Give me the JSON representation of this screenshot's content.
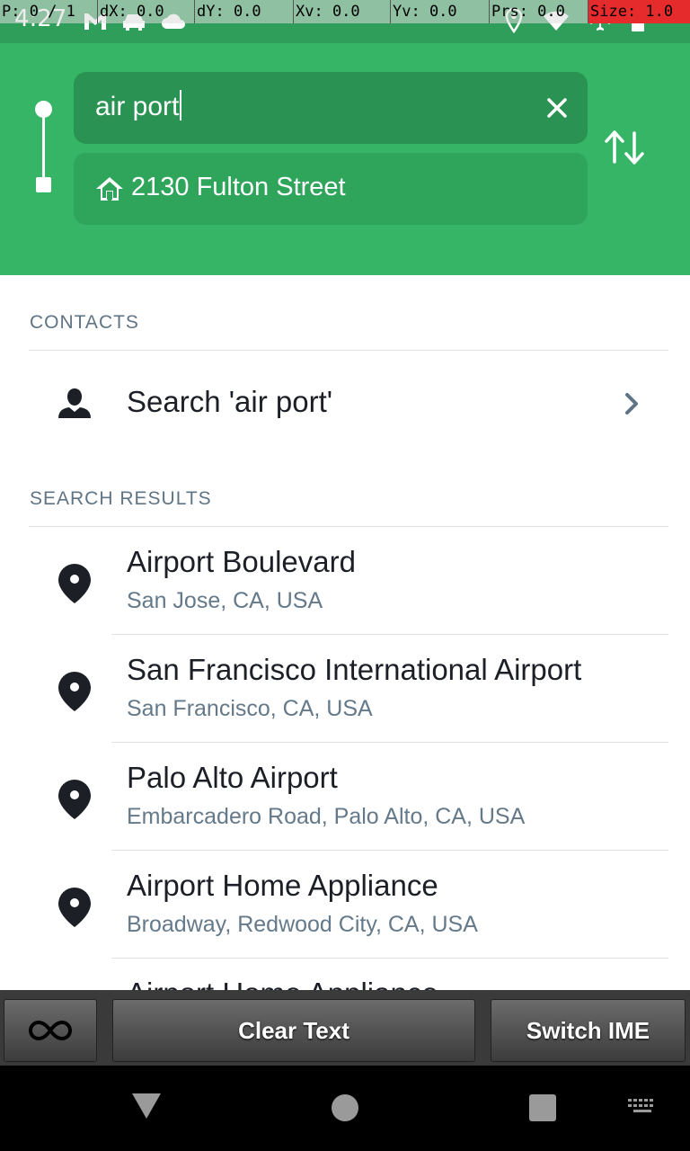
{
  "status_bar": {
    "time": "4:27",
    "icons_left": [
      "gmail-icon",
      "car-icon",
      "cloud-icon"
    ],
    "icons_right": [
      "location-icon",
      "wifi-icon",
      "airplane-icon",
      "battery-icon"
    ]
  },
  "pointer_overlay": {
    "p": "P: 0 / 1",
    "dx": "dX: 0.0",
    "dy": "dY: 0.0",
    "xv": "Xv: 0.0",
    "yv": "Yv: 0.0",
    "prs": "Prs: 0.0",
    "size": "Size: 1.0"
  },
  "route": {
    "origin_value": "air port",
    "destination_value": "2130 Fulton Street"
  },
  "contacts": {
    "section_title": "CONTACTS",
    "search_label": "Search 'air port'"
  },
  "search_results": {
    "section_title": "SEARCH RESULTS",
    "items": [
      {
        "title": "Airport Boulevard",
        "subtitle": "San Jose, CA, USA"
      },
      {
        "title": "San Francisco International Airport",
        "subtitle": "San Francisco, CA, USA"
      },
      {
        "title": "Palo Alto Airport",
        "subtitle": "Embarcadero Road, Palo Alto, CA, USA"
      },
      {
        "title": "Airport Home Appliance",
        "subtitle": "Broadway, Redwood City, CA, USA"
      },
      {
        "title": "Airport Home Appliance",
        "subtitle": ""
      }
    ]
  },
  "toolbar": {
    "clear_text": "Clear Text",
    "switch_ime": "Switch IME"
  },
  "colors": {
    "header_green": "#36b566",
    "origin_field": "#2a9252",
    "destination_field": "#2fa45b"
  }
}
